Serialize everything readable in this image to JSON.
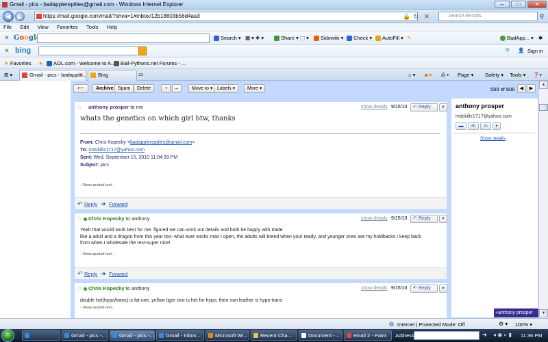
{
  "window": {
    "title": "Gmail - pics - badapplereptiles@gmail.com - Windows Internet Explorer",
    "url": "https://mail.google.com/mail/?shva=1#inbox/12b18803b56d4aa3",
    "search_placeholder": "Search Results"
  },
  "menu": [
    "File",
    "Edit",
    "View",
    "Favorites",
    "Tools",
    "Help"
  ],
  "google_toolbar": {
    "logo": "Google",
    "search": "Search",
    "share": "Share",
    "sidewiki": "Sidewiki",
    "check": "Check",
    "autofill": "AutoFill",
    "account": "BadApp...",
    "icon_colors": {
      "share": "#3a9a3a",
      "check": "#2c66c8",
      "autofill": "#e6a400",
      "account": "#3fa43f"
    }
  },
  "bing_toolbar": {
    "logo": "bing",
    "signin": "Sign in"
  },
  "favorites": {
    "label": "Favorites",
    "items": [
      "AOL.com - Welcome to A...",
      "Ball-Pythons.net Forums - ..."
    ]
  },
  "tabs": [
    {
      "label": "Gmail - pics - badapple..."
    },
    {
      "label": "Bing"
    }
  ],
  "commandbar": {
    "page": "Page",
    "safety": "Safety",
    "tools": "Tools"
  },
  "mail_toolbar": {
    "archive": "Archive",
    "spam": "Spam",
    "delete": "Delete",
    "move_to": "Move to",
    "labels": "Labels",
    "more": "More",
    "count": "589 of 806"
  },
  "messages": [
    {
      "sender": "anthony prosper",
      "to": "to me",
      "show_details": "show details",
      "date": "9/15/10",
      "reply": "Reply",
      "body": "whats the genetics on which girl btw, thanks",
      "quoted_header": {
        "from_label": "From:",
        "from_value": "Chris Kopecky <",
        "from_email": "badapplereptiles@gmail.com",
        "from_end": ">",
        "to_label": "To:",
        "to_value": "mdskillz1717@yahoo.com",
        "sent_label": "Sent:",
        "sent_value": "Wed, September 15, 2010 11:04:39 PM",
        "subject_label": "Subject:",
        "subject_value": "pics"
      },
      "show_quoted": "- Show quoted text -",
      "footer_reply": "Reply",
      "footer_forward": "Forward"
    },
    {
      "sender": "Chris Kopecky",
      "to": "to anthony",
      "show_details": "show details",
      "date": "9/15/10",
      "reply": "Reply",
      "body_lines": [
        "Yeah that would work best for me. figured we can work out details and both be happy with trade.",
        "like a adult and a dragon from this year too- what ever works man I open, the adults will breed when your ready, and younger ones are my holdbacks I keep back",
        "from when I wholesale the rest-super nice!"
      ],
      "show_quoted": "- Show quoted text -",
      "footer_reply": "Reply",
      "footer_forward": "Forward"
    },
    {
      "sender": "Chris Kopecky",
      "to": "to anthony",
      "show_details": "show details",
      "date": "9/15/10",
      "reply": "Reply",
      "body": "double het(hypo/trans) is fat one, yellow tiger one is het for hypo, then non leather is hypo trans",
      "show_quoted": "- Show quoted text -"
    }
  ],
  "contact": {
    "name": "anthony prosper",
    "email": "mdskillz1717@yahoo.com",
    "show_details": "Show details",
    "chat_badge": "+anthony prosper"
  },
  "statusbar": {
    "zone": "Internet | Protected Mode: Off",
    "zoom": "100%"
  },
  "taskbar": {
    "tasks": [
      "Gmail - pics -...",
      "Gmail - pics -...",
      "Gmail - Inbox...",
      "Microsoft Wi...",
      "Recent Cha...",
      "Document - ...",
      "email 2 - Paint"
    ],
    "address_label": "Address",
    "clock": "11:36 PM"
  }
}
